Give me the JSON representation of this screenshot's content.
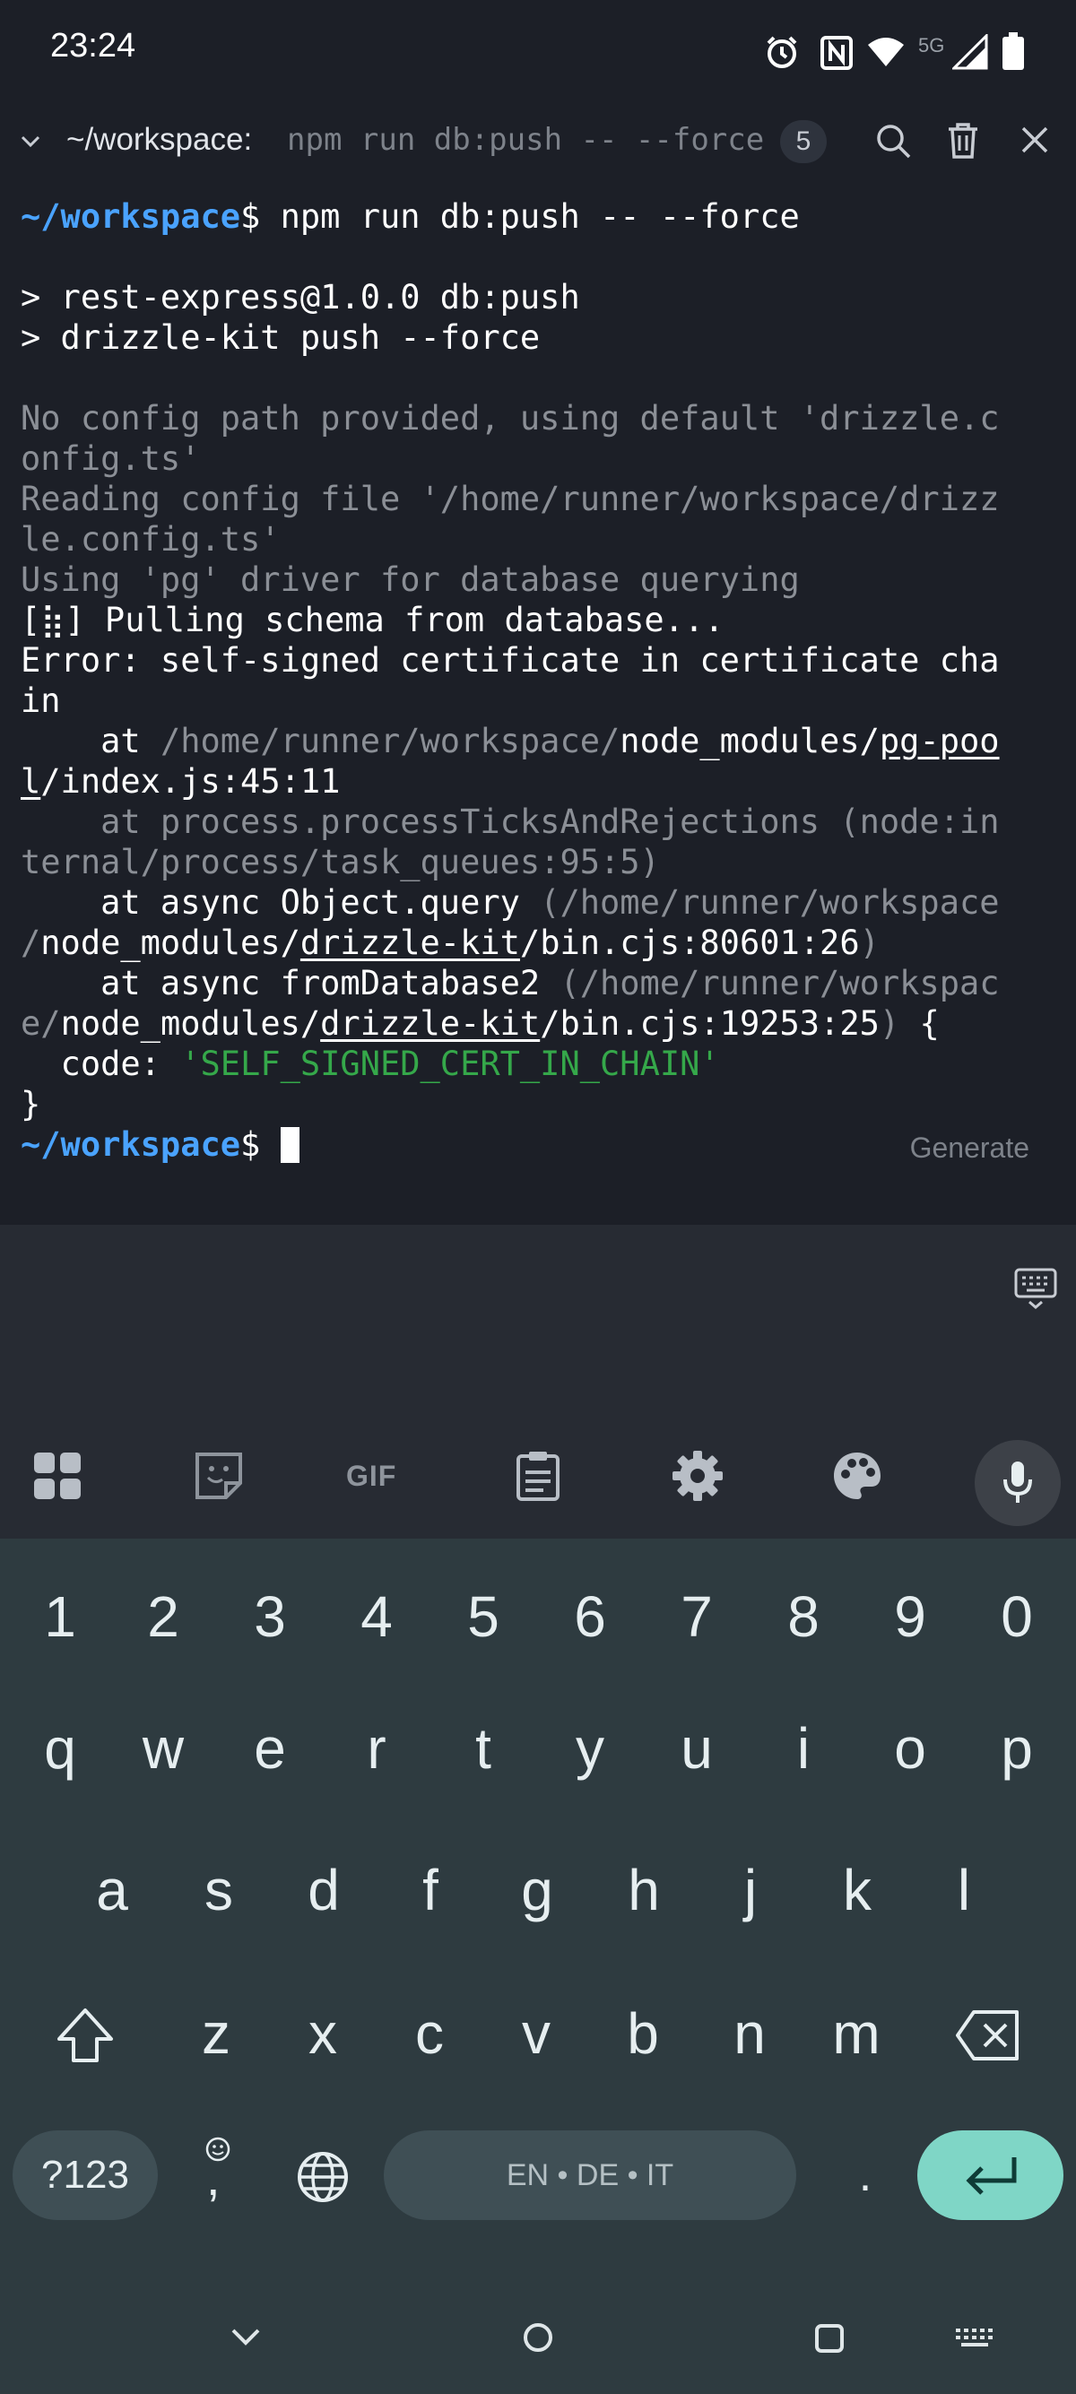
{
  "status_bar": {
    "time": "23:24",
    "network": "5G"
  },
  "terminal_header": {
    "path": "~/workspace:",
    "command": "npm run db:push -- --force",
    "badge_count": "5"
  },
  "terminal": {
    "prompt": "~/workspace",
    "prompt_symbol": "$",
    "cmd": " npm run db:push -- --force",
    "l_script1": "> rest-express@1.0.0 db:push",
    "l_script2": "> drizzle-kit push --force",
    "l_noconfig1": "No config path provided, using default 'drizzle.c",
    "l_noconfig2": "onfig.ts'",
    "l_reading1": "Reading config file '/home/runner/workspace/drizz",
    "l_reading2": "le.config.ts'",
    "l_using": "Using 'pg' driver for database querying",
    "l_pulling": "[⣷] Pulling schema from database...",
    "l_error1": "Error: self-signed certificate in certificate cha",
    "l_error2": "in",
    "st1_at": "    at ",
    "st1_dim": "/home/runner/workspace/",
    "st1_nm": "node_modules/",
    "st1_pkg": "pg-poo",
    "st1_pkg2": "l",
    "st1_rest": "/index.js:45:11",
    "st2_a": "    at process.processTicksAndRejections (node:in",
    "st2_b": "ternal/process/task_queues:95:5)",
    "st3_at": "    at async Object.query ",
    "st3_dim": "(/home/runner/workspace",
    "st3_dim2": "/",
    "st3_nm": "node_modules/",
    "st3_pkg": "drizzle-kit",
    "st3_rest": "/bin.cjs:80601:26",
    "st3_close": ")",
    "st4_at": "    at async fromDatabase2 ",
    "st4_dim": "(/home/runner/workspac",
    "st4_dim2": "e/",
    "st4_nm": "node_modules/",
    "st4_pkg": "drizzle-kit",
    "st4_rest": "/bin.cjs:19253:25",
    "st4_close": ")",
    "st4_brace": " {",
    "code_key": "  code: ",
    "code_val": "'SELF_SIGNED_CERT_IN_CHAIN'",
    "close_brace": "}",
    "generate_label": "Generate"
  },
  "keyboard": {
    "number_row": [
      "1",
      "2",
      "3",
      "4",
      "5",
      "6",
      "7",
      "8",
      "9",
      "0"
    ],
    "row1": [
      "q",
      "w",
      "e",
      "r",
      "t",
      "y",
      "u",
      "i",
      "o",
      "p"
    ],
    "row2": [
      "a",
      "s",
      "d",
      "f",
      "g",
      "h",
      "j",
      "k",
      "l"
    ],
    "row3": [
      "z",
      "x",
      "c",
      "v",
      "b",
      "n",
      "m"
    ],
    "symbols_key": "?123",
    "comma_key": ",",
    "period_key": ".",
    "space_label": "EN • DE • IT",
    "gif_label": "GIF",
    "colors": {
      "enter_key": "#7fd6c6",
      "space_key": "#3f4f55",
      "mic_bg": "#3d4148"
    }
  }
}
